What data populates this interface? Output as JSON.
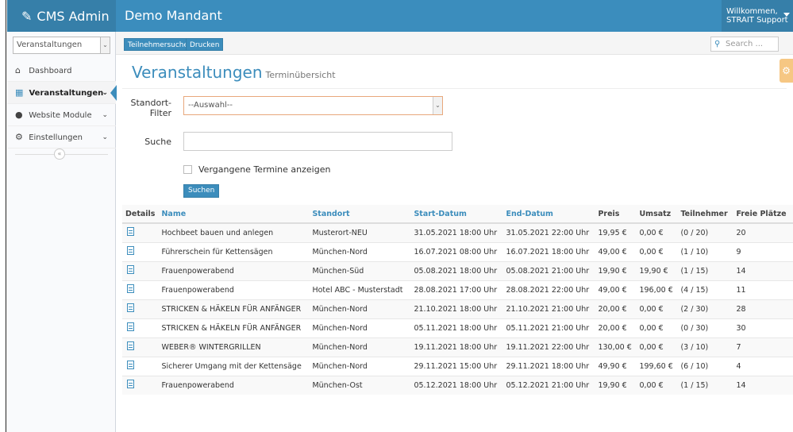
{
  "header": {
    "brand": "CMS Admin",
    "tenant": "Demo Mandant",
    "welcome_line1": "Willkommen,",
    "welcome_line2": "STRAIT Support"
  },
  "sidebar": {
    "select_value": "Veranstaltungen",
    "items": [
      {
        "label": "Dashboard",
        "icon": "home-icon",
        "active": false
      },
      {
        "label": "Veranstaltungen",
        "icon": "calendar-icon",
        "active": true
      },
      {
        "label": "Website Module",
        "icon": "globe-icon",
        "active": false
      },
      {
        "label": "Einstellungen",
        "icon": "cogs-icon",
        "active": false
      }
    ]
  },
  "toolbar": {
    "btn_teilnehmersuche": "Teilnehmersuche",
    "btn_drucken": "Drucken",
    "search_placeholder": "Search ..."
  },
  "page": {
    "title": "Veranstaltungen",
    "subtitle": "Terminübersicht"
  },
  "form": {
    "standort_label_1": "Standort-",
    "standort_label_2": "Filter",
    "standort_value": "--Auswahl--",
    "suche_label": "Suche",
    "suche_value": "",
    "vergangene_label": "Vergangene Termine anzeigen",
    "submit_label": "Suchen"
  },
  "table": {
    "columns": [
      "Details",
      "Name",
      "Standort",
      "Start-Datum",
      "End-Datum",
      "Preis",
      "Umsatz",
      "Teilnehmer",
      "Freie Plätze"
    ],
    "rows": [
      {
        "name": "Hochbeet bauen und anlegen",
        "standort": "Musterort-NEU",
        "start": "31.05.2021 18:00 Uhr",
        "end": "31.05.2021 22:00 Uhr",
        "preis": "19,95 €",
        "umsatz": "0,00 €",
        "teilnehmer": "(0 / 20)",
        "frei": "20"
      },
      {
        "name": "Führerschein für Kettensägen",
        "standort": "München-Nord",
        "start": "16.07.2021 08:00 Uhr",
        "end": "16.07.2021 18:00 Uhr",
        "preis": "49,00 €",
        "umsatz": "0,00 €",
        "teilnehmer": "(1 / 10)",
        "frei": "9"
      },
      {
        "name": "Frauenpowerabend",
        "standort": "München-Süd",
        "start": "05.08.2021 18:00 Uhr",
        "end": "05.08.2021 21:00 Uhr",
        "preis": "19,90 €",
        "umsatz": "19,90 €",
        "teilnehmer": "(1 / 15)",
        "frei": "14"
      },
      {
        "name": "Frauenpowerabend",
        "standort": "Hotel ABC - Musterstadt",
        "start": "28.08.2021 17:00 Uhr",
        "end": "28.08.2021 22:00 Uhr",
        "preis": "49,00 €",
        "umsatz": "196,00 €",
        "teilnehmer": "(4 / 15)",
        "frei": "11"
      },
      {
        "name": "STRICKEN & HÄKELN FÜR ANFÄNGER",
        "standort": "München-Nord",
        "start": "21.10.2021 18:00 Uhr",
        "end": "21.10.2021 21:00 Uhr",
        "preis": "20,00 €",
        "umsatz": "0,00 €",
        "teilnehmer": "(2 / 30)",
        "frei": "28"
      },
      {
        "name": "STRICKEN & HÄKELN FÜR ANFÄNGER",
        "standort": "München-Nord",
        "start": "05.11.2021 18:00 Uhr",
        "end": "05.11.2021 21:00 Uhr",
        "preis": "20,00 €",
        "umsatz": "0,00 €",
        "teilnehmer": "(0 / 30)",
        "frei": "30"
      },
      {
        "name": "WEBER® WINTERGRILLEN",
        "standort": "München-Nord",
        "start": "19.11.2021 18:00 Uhr",
        "end": "19.11.2021 22:00 Uhr",
        "preis": "130,00 €",
        "umsatz": "0,00 €",
        "teilnehmer": "(3 / 10)",
        "frei": "7"
      },
      {
        "name": "Sicherer Umgang mit der Kettensäge",
        "standort": "München-Nord",
        "start": "29.11.2021 15:00 Uhr",
        "end": "29.11.2021 18:00 Uhr",
        "preis": "49,90 €",
        "umsatz": "199,60 €",
        "teilnehmer": "(6 / 10)",
        "frei": "4"
      },
      {
        "name": "Frauenpowerabend",
        "standort": "München-Ost",
        "start": "05.12.2021 18:00 Uhr",
        "end": "05.12.2021 21:00 Uhr",
        "preis": "19,90 €",
        "umsatz": "0,00 €",
        "teilnehmer": "(1 / 15)",
        "frei": "14"
      }
    ]
  },
  "colors": {
    "header_bg": "#3b8dbd",
    "accent": "#3c8dbc",
    "gear_tab": "#f6c783"
  }
}
